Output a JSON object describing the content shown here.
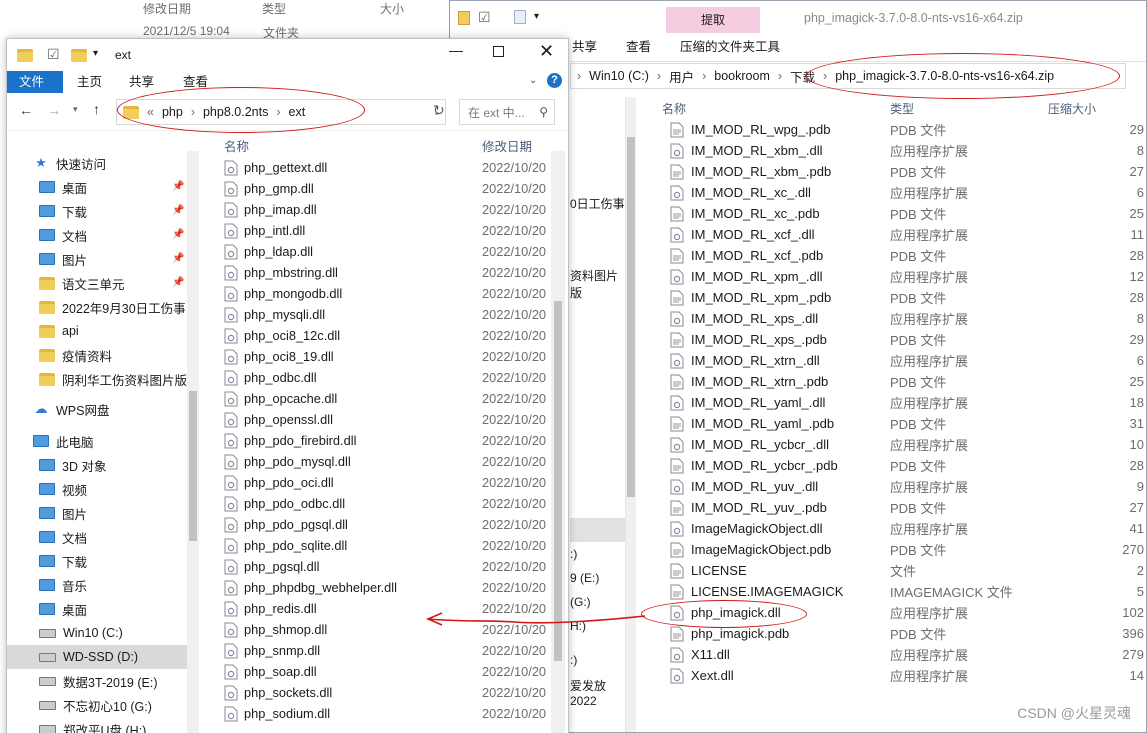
{
  "background_window": {
    "header_date": "修改日期",
    "header_type": "类型",
    "header_size": "大小",
    "row_date": "2021/12/5 19:04",
    "row_type": "文件夹"
  },
  "right_window": {
    "title": "php_imagick-3.7.0-8.0-nts-vs16-x64.zip",
    "extract_tab": "提取",
    "tool_label": "压缩的文件夹工具",
    "tabs": [
      "共享",
      "查看"
    ],
    "breadcrumb": [
      "Win10 (C:)",
      "用户",
      "bookroom",
      "下载",
      "php_imagick-3.7.0-8.0-nts-vs16-x64.zip"
    ],
    "columns": {
      "name": "名称",
      "type": "类型",
      "size": "压缩大小"
    },
    "strip_texts": [
      "0日工伤事",
      "资料图片版",
      ":)",
      "9 (E:)",
      "(G:)",
      "H:)",
      ":)",
      "爱发放2022"
    ],
    "files": [
      {
        "name": "IM_MOD_RL_wpg_.pdb",
        "type": "PDB 文件",
        "size": "29"
      },
      {
        "name": "IM_MOD_RL_xbm_.dll",
        "type": "应用程序扩展",
        "size": "8"
      },
      {
        "name": "IM_MOD_RL_xbm_.pdb",
        "type": "PDB 文件",
        "size": "27"
      },
      {
        "name": "IM_MOD_RL_xc_.dll",
        "type": "应用程序扩展",
        "size": "6"
      },
      {
        "name": "IM_MOD_RL_xc_.pdb",
        "type": "PDB 文件",
        "size": "25"
      },
      {
        "name": "IM_MOD_RL_xcf_.dll",
        "type": "应用程序扩展",
        "size": "11"
      },
      {
        "name": "IM_MOD_RL_xcf_.pdb",
        "type": "PDB 文件",
        "size": "28"
      },
      {
        "name": "IM_MOD_RL_xpm_.dll",
        "type": "应用程序扩展",
        "size": "12"
      },
      {
        "name": "IM_MOD_RL_xpm_.pdb",
        "type": "PDB 文件",
        "size": "28"
      },
      {
        "name": "IM_MOD_RL_xps_.dll",
        "type": "应用程序扩展",
        "size": "8"
      },
      {
        "name": "IM_MOD_RL_xps_.pdb",
        "type": "PDB 文件",
        "size": "29"
      },
      {
        "name": "IM_MOD_RL_xtrn_.dll",
        "type": "应用程序扩展",
        "size": "6"
      },
      {
        "name": "IM_MOD_RL_xtrn_.pdb",
        "type": "PDB 文件",
        "size": "25"
      },
      {
        "name": "IM_MOD_RL_yaml_.dll",
        "type": "应用程序扩展",
        "size": "18"
      },
      {
        "name": "IM_MOD_RL_yaml_.pdb",
        "type": "PDB 文件",
        "size": "31"
      },
      {
        "name": "IM_MOD_RL_ycbcr_.dll",
        "type": "应用程序扩展",
        "size": "10"
      },
      {
        "name": "IM_MOD_RL_ycbcr_.pdb",
        "type": "PDB 文件",
        "size": "28"
      },
      {
        "name": "IM_MOD_RL_yuv_.dll",
        "type": "应用程序扩展",
        "size": "9"
      },
      {
        "name": "IM_MOD_RL_yuv_.pdb",
        "type": "PDB 文件",
        "size": "27"
      },
      {
        "name": "ImageMagickObject.dll",
        "type": "应用程序扩展",
        "size": "41"
      },
      {
        "name": "ImageMagickObject.pdb",
        "type": "PDB 文件",
        "size": "270"
      },
      {
        "name": "LICENSE",
        "type": "文件",
        "size": "2"
      },
      {
        "name": "LICENSE.IMAGEMAGICK",
        "type": "IMAGEMAGICK 文件",
        "size": "5"
      },
      {
        "name": "php_imagick.dll",
        "type": "应用程序扩展",
        "size": "102"
      },
      {
        "name": "php_imagick.pdb",
        "type": "PDB 文件",
        "size": "396"
      },
      {
        "name": "X11.dll",
        "type": "应用程序扩展",
        "size": "279"
      },
      {
        "name": "Xext.dll",
        "type": "应用程序扩展",
        "size": "14"
      }
    ]
  },
  "left_window": {
    "title": "ext",
    "tabs": {
      "file": "文件",
      "home": "主页",
      "share": "共享",
      "view": "查看"
    },
    "breadcrumb": [
      "php",
      "php8.0.2nts",
      "ext"
    ],
    "breadcrumb_prefix": "«",
    "search_placeholder": "在 ext 中...",
    "columns": {
      "name": "名称",
      "date": "修改日期"
    },
    "nav": {
      "quick_access": "快速访问",
      "quick_items": [
        {
          "label": "桌面",
          "pinned": true
        },
        {
          "label": "下载",
          "pinned": true
        },
        {
          "label": "文档",
          "pinned": true
        },
        {
          "label": "图片",
          "pinned": true
        },
        {
          "label": "语文三单元",
          "pinned": true
        },
        {
          "label": "2022年9月30日工伤事",
          "pinned": false
        },
        {
          "label": "api",
          "pinned": false
        },
        {
          "label": "疫情资料",
          "pinned": false
        },
        {
          "label": "阴利华工伤资料图片版",
          "pinned": false
        }
      ],
      "wps": "WPS网盘",
      "this_pc": "此电脑",
      "pc_items": [
        "3D 对象",
        "视频",
        "图片",
        "文档",
        "下载",
        "音乐",
        "桌面"
      ],
      "drives": [
        "Win10 (C:)",
        "WD-SSD (D:)",
        "数据3T-2019 (E:)",
        "不忘初心10 (G:)",
        "郑改平U盘 (H:)"
      ],
      "selected_drive": "WD-SSD (D:)"
    },
    "files": [
      {
        "name": "php_gettext.dll",
        "date": "2022/10/20"
      },
      {
        "name": "php_gmp.dll",
        "date": "2022/10/20"
      },
      {
        "name": "php_imap.dll",
        "date": "2022/10/20"
      },
      {
        "name": "php_intl.dll",
        "date": "2022/10/20"
      },
      {
        "name": "php_ldap.dll",
        "date": "2022/10/20"
      },
      {
        "name": "php_mbstring.dll",
        "date": "2022/10/20"
      },
      {
        "name": "php_mongodb.dll",
        "date": "2022/10/20"
      },
      {
        "name": "php_mysqli.dll",
        "date": "2022/10/20"
      },
      {
        "name": "php_oci8_12c.dll",
        "date": "2022/10/20"
      },
      {
        "name": "php_oci8_19.dll",
        "date": "2022/10/20"
      },
      {
        "name": "php_odbc.dll",
        "date": "2022/10/20"
      },
      {
        "name": "php_opcache.dll",
        "date": "2022/10/20"
      },
      {
        "name": "php_openssl.dll",
        "date": "2022/10/20"
      },
      {
        "name": "php_pdo_firebird.dll",
        "date": "2022/10/20"
      },
      {
        "name": "php_pdo_mysql.dll",
        "date": "2022/10/20"
      },
      {
        "name": "php_pdo_oci.dll",
        "date": "2022/10/20"
      },
      {
        "name": "php_pdo_odbc.dll",
        "date": "2022/10/20"
      },
      {
        "name": "php_pdo_pgsql.dll",
        "date": "2022/10/20"
      },
      {
        "name": "php_pdo_sqlite.dll",
        "date": "2022/10/20"
      },
      {
        "name": "php_pgsql.dll",
        "date": "2022/10/20"
      },
      {
        "name": "php_phpdbg_webhelper.dll",
        "date": "2022/10/20"
      },
      {
        "name": "php_redis.dll",
        "date": "2022/10/20"
      },
      {
        "name": "php_shmop.dll",
        "date": "2022/10/20"
      },
      {
        "name": "php_snmp.dll",
        "date": "2022/10/20"
      },
      {
        "name": "php_soap.dll",
        "date": "2022/10/20"
      },
      {
        "name": "php_sockets.dll",
        "date": "2022/10/20"
      },
      {
        "name": "php_sodium.dll",
        "date": "2022/10/20"
      }
    ]
  },
  "watermark": "CSDN @火星灵魂",
  "colors": {
    "annotation": "#d01818",
    "accent": "#1a73c8",
    "extract_tab": "#f6cce0"
  }
}
